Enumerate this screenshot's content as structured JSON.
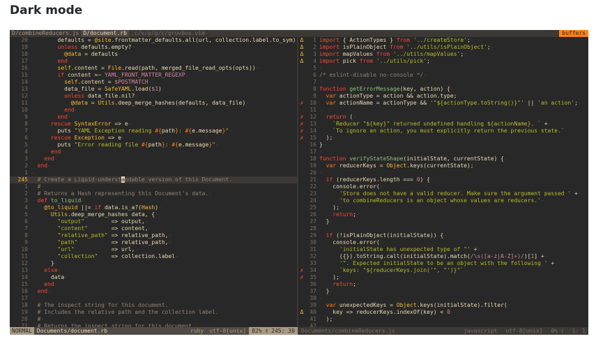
{
  "page": {
    "title": "Dark mode"
  },
  "tabline": {
    "tabs": [
      {
        "label": "D/combineReducers.js",
        "state": "normal"
      },
      {
        "label": "D/document.rb",
        "state": "active"
      },
      {
        "label": ".c/v/p/g/c/gruvbox.vim",
        "state": "inactive"
      }
    ],
    "buffers_label": "buffers"
  },
  "left_pane": {
    "lines": [
      {
        "n": "20",
        "sign": "",
        "html": "        defaults = <span class='y'>@site</span>.frontmatter_defaults.all(url, collection.label.to_sym)<span class='nl'>-</span>"
      },
      {
        "n": "19",
        "sign": "",
        "html": "        <span class='k'>unless</span> defaults.empty?<span class='nl'>-</span>"
      },
      {
        "n": "18",
        "sign": "",
        "html": "          <span class='y'>@data</span> = defaults<span class='nl'>-</span>"
      },
      {
        "n": "17",
        "sign": "",
        "html": "        <span class='k'>end</span><span class='nl'>-</span>"
      },
      {
        "n": "16",
        "sign": "",
        "html": "        <span class='y'>self</span>.content = <span class='y'>File</span>.read(path, merged_file_read_opts(opts))<span class='nl'>-</span>"
      },
      {
        "n": "15",
        "sign": "",
        "html": "        <span class='k'>if</span> content =~ <span class='p'>YAML_FRONT_MATTER_REGEXP</span><span class='nl'>-</span>"
      },
      {
        "n": "14",
        "sign": "",
        "html": "          <span class='y'>self</span>.content = <span class='p'>$POSTMATCH</span><span class='nl'>-</span>"
      },
      {
        "n": "13",
        "sign": "",
        "html": "          data_file = <span class='y'>SafeYAML</span>.load(<span class='p'>$1</span>)<span class='nl'>-</span>"
      },
      {
        "n": "12",
        "sign": "",
        "html": "          <span class='k'>unless</span> data_file.nil?<span class='nl'>-</span>"
      },
      {
        "n": "11",
        "sign": "",
        "html": "            <span class='y'>@data</span> = <span class='y'>Utils</span>.deep_merge_hashes(defaults, data_file)<span class='nl'>-</span>"
      },
      {
        "n": "10",
        "sign": "",
        "html": "          <span class='k'>end</span><span class='nl'>-</span>"
      },
      {
        "n": "9",
        "sign": "",
        "html": "        <span class='k'>end</span><span class='nl'>-</span>"
      },
      {
        "n": "8",
        "sign": "",
        "html": "      <span class='k'>rescue</span> <span class='y'>SyntaxError</span> =&gt; e<span class='nl'>-</span>"
      },
      {
        "n": "7",
        "sign": "",
        "html": "        puts <span class='s'>\"YAML Exception reading </span><span class='o'>#{</span>path<span class='o'>}</span><span class='s'>: </span><span class='o'>#{</span>e.message<span class='o'>}</span><span class='s'>\"</span><span class='nl'>-</span>"
      },
      {
        "n": "6",
        "sign": "",
        "html": "      <span class='k'>rescue</span> <span class='y'>Exception</span> =&gt; e<span class='nl'>-</span>"
      },
      {
        "n": "5",
        "sign": "",
        "html": "        puts <span class='s'>\"Error reading file </span><span class='o'>#{</span>path<span class='o'>}</span><span class='s'>: </span><span class='o'>#{</span>e.message<span class='o'>}</span><span class='s'>\"</span><span class='nl'>-</span>"
      },
      {
        "n": "4",
        "sign": "",
        "html": "      <span class='k'>end</span><span class='nl'>-</span>"
      },
      {
        "n": "3",
        "sign": "",
        "html": "    <span class='k'>end</span><span class='nl'>-</span>"
      },
      {
        "n": "2",
        "sign": "",
        "html": "  <span class='k'>end</span><span class='nl'>-</span>"
      },
      {
        "n": "1",
        "sign": "",
        "html": "<span class='nl'>-</span>"
      },
      {
        "n": "245",
        "sign": "",
        "cursor": true,
        "html": "  <span class='c'># Create a Liquid-underst</span><span class='cursor'>a</span><span class='c'>ndable version of this Document.</span><span class='nl'>-</span>"
      },
      {
        "n": "1",
        "sign": "",
        "html": "  <span class='c'>#</span><span class='nl'>-</span>"
      },
      {
        "n": "2",
        "sign": "",
        "html": "  <span class='c'># Returns a Hash representing this Document's data.</span><span class='nl'>-</span>"
      },
      {
        "n": "3",
        "sign": "",
        "html": "  <span class='k'>def</span> <span class='a'>to_liquid</span><span class='nl'>-</span>"
      },
      {
        "n": "4",
        "sign": "",
        "html": "    <span class='y'>@to_liquid</span> ||= <span class='k'>if</span> data.is_a?(<span class='y'>Hash</span>)<span class='nl'>-</span>"
      },
      {
        "n": "5",
        "sign": "",
        "html": "      <span class='y'>Utils</span>.deep_merge_hashes data, {<span class='nl'>-</span>"
      },
      {
        "n": "6",
        "sign": "",
        "html": "        <span class='s'>\"output\"</span>        =&gt; output,<span class='nl'>-</span>"
      },
      {
        "n": "7",
        "sign": "",
        "html": "        <span class='s'>\"content\"</span>       =&gt; content,<span class='nl'>-</span>"
      },
      {
        "n": "8",
        "sign": "",
        "html": "        <span class='s'>\"relative_path\"</span> =&gt; relative_path,<span class='nl'>-</span>"
      },
      {
        "n": "9",
        "sign": "",
        "html": "        <span class='s'>\"path\"</span>          =&gt; relative_path,<span class='nl'>-</span>"
      },
      {
        "n": "10",
        "sign": "",
        "html": "        <span class='s'>\"url\"</span>           =&gt; url,<span class='nl'>-</span>"
      },
      {
        "n": "11",
        "sign": "",
        "html": "        <span class='s'>\"collection\"</span>    =&gt; collection.label<span class='nl'>-</span>"
      },
      {
        "n": "12",
        "sign": "",
        "html": "      }<span class='nl'>-</span>"
      },
      {
        "n": "13",
        "sign": "",
        "html": "    <span class='k'>else</span><span class='nl'>-</span>"
      },
      {
        "n": "14",
        "sign": "",
        "html": "      data<span class='nl'>-</span>"
      },
      {
        "n": "15",
        "sign": "",
        "html": "    <span class='k'>end</span><span class='nl'>-</span>"
      },
      {
        "n": "16",
        "sign": "",
        "html": "  <span class='k'>end</span><span class='nl'>-</span>"
      },
      {
        "n": "17",
        "sign": "",
        "html": "<span class='nl'>-</span>"
      },
      {
        "n": "18",
        "sign": "",
        "html": "  <span class='c'># The inspect string for this document.</span><span class='nl'>-</span>"
      },
      {
        "n": "19",
        "sign": "",
        "html": "  <span class='c'># Includes the relative path and the collection label.</span><span class='nl'>-</span>"
      },
      {
        "n": "20",
        "sign": "",
        "html": "  <span class='c'>#</span><span class='nl'>-</span>"
      },
      {
        "n": "21",
        "sign": "",
        "html": "  <span class='c'># Returns the inspect string for this document.</span><span class='nl'>-</span>"
      }
    ]
  },
  "right_pane": {
    "lines": [
      {
        "n": "1",
        "sign": "warn",
        "html": "<span class='k'>import</span> { ActionTypes } <span class='k'>from</span> <span class='s'>'../createStore'</span>;<span class='nl'>-</span>"
      },
      {
        "n": "2",
        "sign": "warn",
        "html": "<span class='k'>import</span> isPlainObject <span class='k'>from</span> <span class='s'>'../utils/isPlainObject'</span>;<span class='nl'>-</span>"
      },
      {
        "n": "3",
        "sign": "warn",
        "html": "<span class='k'>import</span> mapValues <span class='k'>from</span> <span class='s'>'../utils/mapValues'</span>;<span class='nl'>-</span>"
      },
      {
        "n": "4",
        "sign": "warn",
        "html": "<span class='k'>import</span> pick <span class='k'>from</span> <span class='s'>'../utils/pick'</span>;<span class='nl'>-</span>"
      },
      {
        "n": "5",
        "sign": "",
        "html": "<span class='nl'>-</span>"
      },
      {
        "n": "6",
        "sign": "",
        "html": "<span class='c'>/* eslint-disable no-console */</span><span class='nl'>-</span>"
      },
      {
        "n": "7",
        "sign": "",
        "html": "<span class='nl'>-</span>"
      },
      {
        "n": "8",
        "sign": "",
        "html": "<span class='k'>function</span> <span class='a'>getErrorMessage</span>(key, action) {<span class='nl'>-</span>"
      },
      {
        "n": "9",
        "sign": "",
        "html": "  <span class='o'>var</span> actionType = action &amp;&amp; action.type;<span class='nl'>-</span>"
      },
      {
        "n": "10",
        "sign": "err",
        "html": "  <span class='o'>var</span> actionName = actionType &amp;&amp; <span class='s'>'\"${actionType.toString()}\"'</span> || <span class='s'>'an action'</span>;<span class='nl'>-</span>"
      },
      {
        "n": "11",
        "sign": "",
        "html": "<span class='nl'>-</span>"
      },
      {
        "n": "12",
        "sign": "err",
        "html": "  <span class='k'>return</span> (<span class='nl'>-</span>"
      },
      {
        "n": "13",
        "sign": "err",
        "html": "    <span class='s'>`Reducer \"${key}\" returned undefined handling ${actionName}. `</span> +<span class='nl'>-</span>"
      },
      {
        "n": "14",
        "sign": "err",
        "html": "    <span class='s'>`To ignore an action, you must explicitly return the previous state.`</span><span class='nl'>-</span>"
      },
      {
        "n": "15",
        "sign": "err",
        "html": "  );<span class='nl'>-</span>"
      },
      {
        "n": "16",
        "sign": "",
        "html": "}<span class='nl'>-</span>"
      },
      {
        "n": "17",
        "sign": "",
        "html": "<span class='nl'>-</span>"
      },
      {
        "n": "18",
        "sign": "",
        "html": "<span class='k'>function</span> <span class='a'>verifyStateShape</span>(initialState, currentState) {<span class='nl'>-</span>"
      },
      {
        "n": "19",
        "sign": "",
        "html": "  <span class='o'>var</span> reducerKeys = <span class='y'>Object</span>.keys(currentState);<span class='nl'>-</span>"
      },
      {
        "n": "20",
        "sign": "",
        "html": "<span class='nl'>-</span>"
      },
      {
        "n": "21",
        "sign": "",
        "html": "  <span class='k'>if</span> (reducerKeys.length === <span class='p'>0</span>) {<span class='nl'>-</span>"
      },
      {
        "n": "22",
        "sign": "",
        "html": "    console.error(<span class='nl'>-</span>"
      },
      {
        "n": "23",
        "sign": "",
        "html": "      <span class='s'>'Store does not have a valid reducer. Make sure the argument passed '</span> +<span class='nl'>-</span>"
      },
      {
        "n": "24",
        "sign": "",
        "html": "      <span class='s'>'to combineReducers is an object whose values are reducers.'</span><span class='nl'>-</span>"
      },
      {
        "n": "25",
        "sign": "",
        "html": "    );<span class='nl'>-</span>"
      },
      {
        "n": "26",
        "sign": "",
        "html": "    <span class='k'>return</span>;<span class='nl'>-</span>"
      },
      {
        "n": "27",
        "sign": "",
        "html": "  }<span class='nl'>-</span>"
      },
      {
        "n": "28",
        "sign": "",
        "html": "<span class='nl'>-</span>"
      },
      {
        "n": "29",
        "sign": "",
        "html": "  <span class='k'>if</span> (!isPlainObject(initialState)) {<span class='nl'>-</span>"
      },
      {
        "n": "30",
        "sign": "",
        "html": "    console.error(<span class='nl'>-</span>"
      },
      {
        "n": "31",
        "sign": "",
        "html": "      <span class='s'>'initialState has unexpected type of \"'</span> +<span class='nl'>-</span>"
      },
      {
        "n": "32",
        "sign": "",
        "html": "      ({}).toString.call(initialState).match(<span class='p'>/\\s([a-z|A-Z]+)/</span>)[<span class='p'>1</span>] +<span class='nl'>-</span>"
      },
      {
        "n": "33",
        "sign": "",
        "html": "      <span class='s'>'\". Expected initialState to be an object with the following '</span> +<span class='nl'>-</span>"
      },
      {
        "n": "34",
        "sign": "err",
        "html": "      <span class='s'>`keys: \"${reducerKeys.join('\", \"')}\"`</span><span class='nl'>-</span>"
      },
      {
        "n": "35",
        "sign": "err",
        "html": "    );<span class='nl'>-</span>"
      },
      {
        "n": "36",
        "sign": "",
        "html": "    <span class='k'>return</span>;<span class='nl'>-</span>"
      },
      {
        "n": "37",
        "sign": "",
        "html": "  }<span class='nl'>-</span>"
      },
      {
        "n": "38",
        "sign": "",
        "html": "<span class='nl'>-</span>"
      },
      {
        "n": "39",
        "sign": "",
        "html": "  <span class='o'>var</span> unexpectedKeys = <span class='y'>Object</span>.keys(initialState).filter(<span class='nl'>-</span>"
      },
      {
        "n": "40",
        "sign": "warn",
        "html": "    key =&gt; reducerKeys.indexOf(key) &lt; <span class='p'>0</span><span class='nl'>-</span>"
      },
      {
        "n": "41",
        "sign": "",
        "html": "  );<span class='nl'>-</span>"
      },
      {
        "n": "42",
        "sign": "",
        "html": "<span class='nl'>-</span>"
      }
    ]
  },
  "statusline": {
    "mode": "NORMAL",
    "file": "Documents/document.rb",
    "filetype": "ruby",
    "encoding": "utf-8[unix]",
    "position": "82%  ℓ 245: 30",
    "inactive_file": "Documents/combineReducers.js",
    "inactive_filetype": "javascript",
    "inactive_encoding": "utf-8[unix]",
    "inactive_percent": "0%  ℓ",
    "inactive_pos": "1:  1"
  },
  "signs": {
    "warn": "Δ",
    "err": "✗"
  },
  "colors": {
    "background": "#282828",
    "foreground": "#ebdbb2",
    "accent_orange": "#fe8019",
    "warn": "#fabd2f",
    "error": "#fb4934"
  }
}
